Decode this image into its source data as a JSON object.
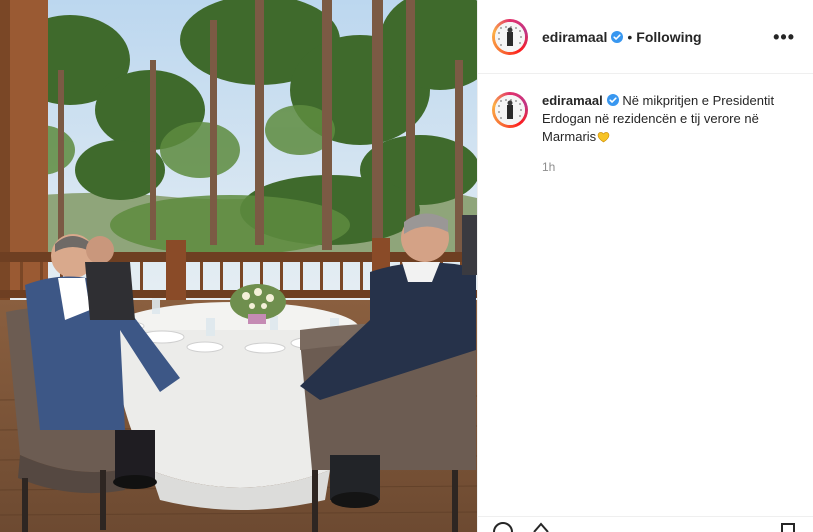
{
  "post": {
    "author": {
      "username": "ediramaal",
      "verified": true,
      "follow_status": "Following",
      "avatar_icon": "profile-photo-icon"
    },
    "more_label": "•••",
    "caption": {
      "username": "ediramaal",
      "text": "Në mikpritjen e Presidentit Erdogan në rezidencën e tij verore në Marmaris",
      "emoji": "yellow-heart-emoji"
    },
    "timestamp": "1h",
    "media": {
      "description_icon": "photo-content"
    },
    "actions": {
      "icons": [
        "comment-icon",
        "share-icon",
        "bookmark-icon"
      ]
    },
    "colors": {
      "verified_blue": "#3897f0",
      "secondary_text": "#8e8e8e",
      "border": "#efefef"
    }
  }
}
